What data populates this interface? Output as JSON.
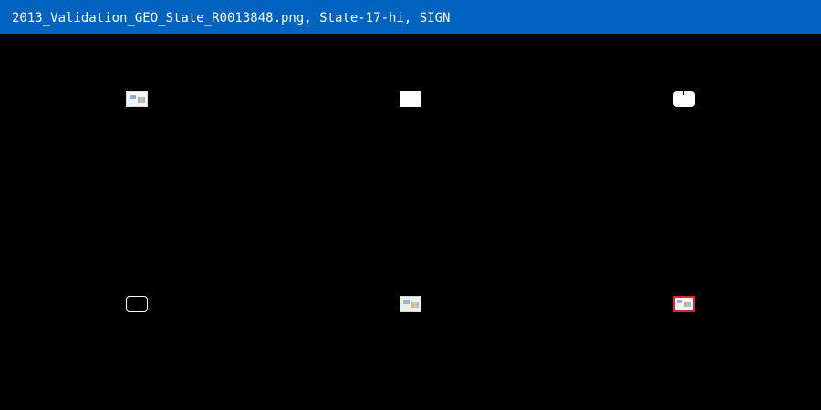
{
  "window": {
    "title": "2013_Validation_GEO_State_R0013848.png, State-17-hi, SIGN"
  },
  "panels": [
    {
      "kind": "original-image",
      "icon": "sign-thumbnail-icon"
    },
    {
      "kind": "white-mask",
      "icon": "mask-icon"
    },
    {
      "kind": "white-mask-notched",
      "icon": "mask-icon"
    },
    {
      "kind": "mask-outline",
      "icon": "outline-icon"
    },
    {
      "kind": "masked-image",
      "icon": "sign-thumbnail-icon"
    },
    {
      "kind": "detection-box",
      "icon": "sign-thumbnail-icon"
    }
  ],
  "colors": {
    "titlebar": "#0063c0",
    "titlebar_text": "#ffffff",
    "background": "#000000",
    "detection_border": "#e0222a"
  }
}
